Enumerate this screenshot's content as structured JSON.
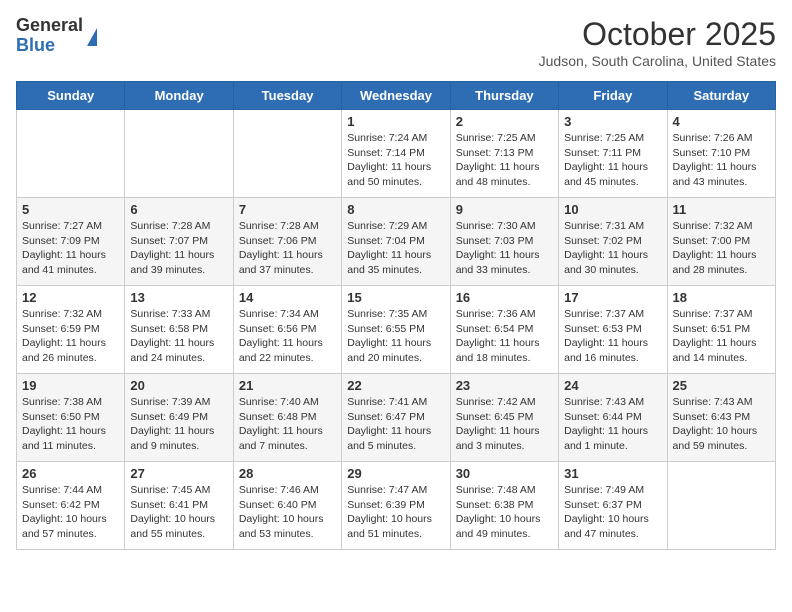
{
  "logo": {
    "general": "General",
    "blue": "Blue"
  },
  "header": {
    "month": "October 2025",
    "location": "Judson, South Carolina, United States"
  },
  "days_of_week": [
    "Sunday",
    "Monday",
    "Tuesday",
    "Wednesday",
    "Thursday",
    "Friday",
    "Saturday"
  ],
  "weeks": [
    [
      {
        "day": "",
        "info": ""
      },
      {
        "day": "",
        "info": ""
      },
      {
        "day": "",
        "info": ""
      },
      {
        "day": "1",
        "info": "Sunrise: 7:24 AM\nSunset: 7:14 PM\nDaylight: 11 hours\nand 50 minutes."
      },
      {
        "day": "2",
        "info": "Sunrise: 7:25 AM\nSunset: 7:13 PM\nDaylight: 11 hours\nand 48 minutes."
      },
      {
        "day": "3",
        "info": "Sunrise: 7:25 AM\nSunset: 7:11 PM\nDaylight: 11 hours\nand 45 minutes."
      },
      {
        "day": "4",
        "info": "Sunrise: 7:26 AM\nSunset: 7:10 PM\nDaylight: 11 hours\nand 43 minutes."
      }
    ],
    [
      {
        "day": "5",
        "info": "Sunrise: 7:27 AM\nSunset: 7:09 PM\nDaylight: 11 hours\nand 41 minutes."
      },
      {
        "day": "6",
        "info": "Sunrise: 7:28 AM\nSunset: 7:07 PM\nDaylight: 11 hours\nand 39 minutes."
      },
      {
        "day": "7",
        "info": "Sunrise: 7:28 AM\nSunset: 7:06 PM\nDaylight: 11 hours\nand 37 minutes."
      },
      {
        "day": "8",
        "info": "Sunrise: 7:29 AM\nSunset: 7:04 PM\nDaylight: 11 hours\nand 35 minutes."
      },
      {
        "day": "9",
        "info": "Sunrise: 7:30 AM\nSunset: 7:03 PM\nDaylight: 11 hours\nand 33 minutes."
      },
      {
        "day": "10",
        "info": "Sunrise: 7:31 AM\nSunset: 7:02 PM\nDaylight: 11 hours\nand 30 minutes."
      },
      {
        "day": "11",
        "info": "Sunrise: 7:32 AM\nSunset: 7:00 PM\nDaylight: 11 hours\nand 28 minutes."
      }
    ],
    [
      {
        "day": "12",
        "info": "Sunrise: 7:32 AM\nSunset: 6:59 PM\nDaylight: 11 hours\nand 26 minutes."
      },
      {
        "day": "13",
        "info": "Sunrise: 7:33 AM\nSunset: 6:58 PM\nDaylight: 11 hours\nand 24 minutes."
      },
      {
        "day": "14",
        "info": "Sunrise: 7:34 AM\nSunset: 6:56 PM\nDaylight: 11 hours\nand 22 minutes."
      },
      {
        "day": "15",
        "info": "Sunrise: 7:35 AM\nSunset: 6:55 PM\nDaylight: 11 hours\nand 20 minutes."
      },
      {
        "day": "16",
        "info": "Sunrise: 7:36 AM\nSunset: 6:54 PM\nDaylight: 11 hours\nand 18 minutes."
      },
      {
        "day": "17",
        "info": "Sunrise: 7:37 AM\nSunset: 6:53 PM\nDaylight: 11 hours\nand 16 minutes."
      },
      {
        "day": "18",
        "info": "Sunrise: 7:37 AM\nSunset: 6:51 PM\nDaylight: 11 hours\nand 14 minutes."
      }
    ],
    [
      {
        "day": "19",
        "info": "Sunrise: 7:38 AM\nSunset: 6:50 PM\nDaylight: 11 hours\nand 11 minutes."
      },
      {
        "day": "20",
        "info": "Sunrise: 7:39 AM\nSunset: 6:49 PM\nDaylight: 11 hours\nand 9 minutes."
      },
      {
        "day": "21",
        "info": "Sunrise: 7:40 AM\nSunset: 6:48 PM\nDaylight: 11 hours\nand 7 minutes."
      },
      {
        "day": "22",
        "info": "Sunrise: 7:41 AM\nSunset: 6:47 PM\nDaylight: 11 hours\nand 5 minutes."
      },
      {
        "day": "23",
        "info": "Sunrise: 7:42 AM\nSunset: 6:45 PM\nDaylight: 11 hours\nand 3 minutes."
      },
      {
        "day": "24",
        "info": "Sunrise: 7:43 AM\nSunset: 6:44 PM\nDaylight: 11 hours\nand 1 minute."
      },
      {
        "day": "25",
        "info": "Sunrise: 7:43 AM\nSunset: 6:43 PM\nDaylight: 10 hours\nand 59 minutes."
      }
    ],
    [
      {
        "day": "26",
        "info": "Sunrise: 7:44 AM\nSunset: 6:42 PM\nDaylight: 10 hours\nand 57 minutes."
      },
      {
        "day": "27",
        "info": "Sunrise: 7:45 AM\nSunset: 6:41 PM\nDaylight: 10 hours\nand 55 minutes."
      },
      {
        "day": "28",
        "info": "Sunrise: 7:46 AM\nSunset: 6:40 PM\nDaylight: 10 hours\nand 53 minutes."
      },
      {
        "day": "29",
        "info": "Sunrise: 7:47 AM\nSunset: 6:39 PM\nDaylight: 10 hours\nand 51 minutes."
      },
      {
        "day": "30",
        "info": "Sunrise: 7:48 AM\nSunset: 6:38 PM\nDaylight: 10 hours\nand 49 minutes."
      },
      {
        "day": "31",
        "info": "Sunrise: 7:49 AM\nSunset: 6:37 PM\nDaylight: 10 hours\nand 47 minutes."
      },
      {
        "day": "",
        "info": ""
      }
    ]
  ]
}
